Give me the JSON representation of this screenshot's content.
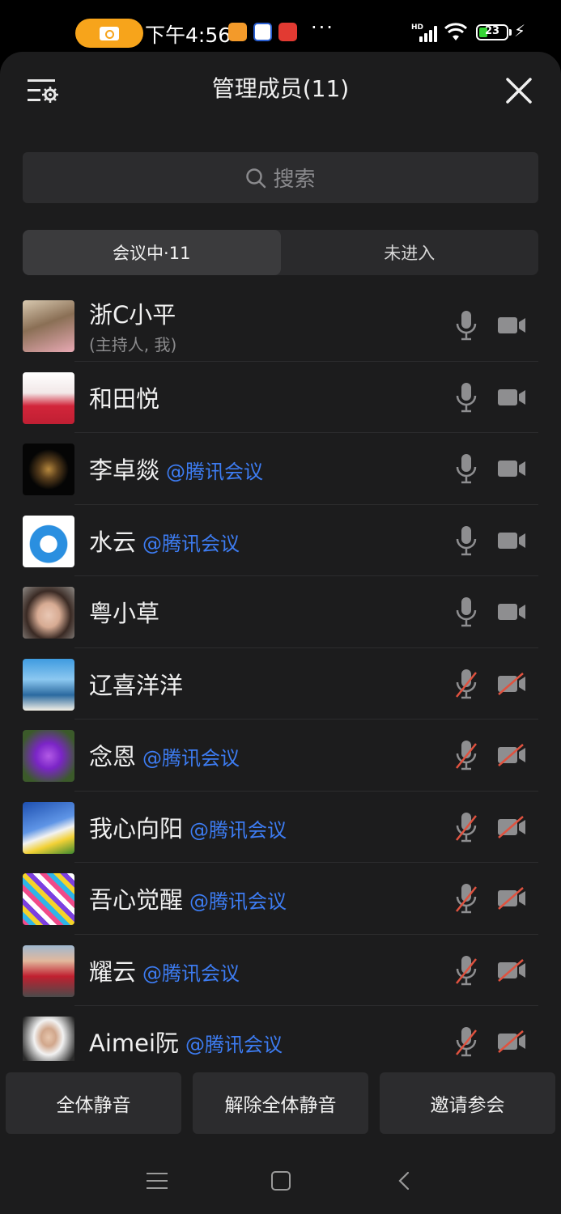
{
  "status_bar": {
    "time": "下午4:56",
    "dots": "···",
    "hd": "HD",
    "battery": "23",
    "icons": [
      "camera-recording-icon",
      "app-icon-orange",
      "app-icon-blue",
      "app-icon-red",
      "signal-icon",
      "wifi-icon",
      "battery-icon",
      "charging-icon"
    ]
  },
  "header": {
    "title": "管理成员(11)",
    "settings_icon": "list-settings-icon",
    "close_icon": "close-icon"
  },
  "search": {
    "placeholder": "搜索"
  },
  "tabs": [
    {
      "label": "会议中·11",
      "active": true
    },
    {
      "label": "未进入",
      "active": false
    }
  ],
  "members": [
    {
      "name": "浙C小平",
      "sub": "(主持人, 我)",
      "tag": "",
      "mic_muted": false,
      "cam_off": false
    },
    {
      "name": "和田悦",
      "sub": "",
      "tag": "",
      "mic_muted": false,
      "cam_off": false
    },
    {
      "name": "李卓燚",
      "sub": "",
      "tag": "@腾讯会议",
      "mic_muted": false,
      "cam_off": false
    },
    {
      "name": "水云",
      "sub": "",
      "tag": "@腾讯会议",
      "mic_muted": false,
      "cam_off": false
    },
    {
      "name": "粤小草",
      "sub": "",
      "tag": "",
      "mic_muted": false,
      "cam_off": false
    },
    {
      "name": "辽喜洋洋",
      "sub": "",
      "tag": "",
      "mic_muted": true,
      "cam_off": true
    },
    {
      "name": "念恩",
      "sub": "",
      "tag": "@腾讯会议",
      "mic_muted": true,
      "cam_off": true
    },
    {
      "name": "我心向阳",
      "sub": "",
      "tag": "@腾讯会议",
      "mic_muted": true,
      "cam_off": true
    },
    {
      "name": "吾心觉醒",
      "sub": "",
      "tag": "@腾讯会议",
      "mic_muted": true,
      "cam_off": true
    },
    {
      "name": "耀云",
      "sub": "",
      "tag": "@腾讯会议",
      "mic_muted": true,
      "cam_off": true
    },
    {
      "name": "Aimei阮",
      "sub": "",
      "tag": "@腾讯会议",
      "mic_muted": true,
      "cam_off": true
    }
  ],
  "actions": {
    "mute_all": "全体静音",
    "unmute_all": "解除全体静音",
    "invite": "邀请参会"
  },
  "nav": [
    "menu-icon",
    "home-icon",
    "back-icon"
  ],
  "colors": {
    "panel_bg": "#1c1c1d",
    "accent_tag": "#3d7cf2",
    "muted_slash": "#e0523f",
    "recording_pill": "#f7a41b"
  }
}
